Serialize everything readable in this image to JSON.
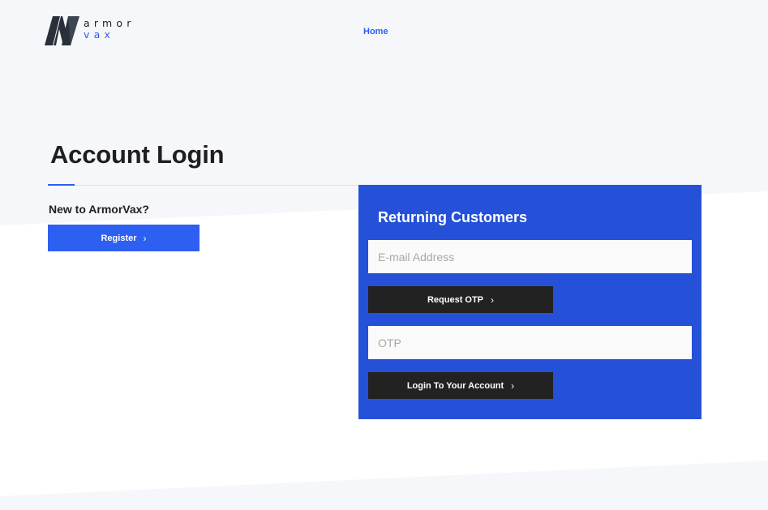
{
  "brand": {
    "logo_top": "armor",
    "logo_bottom": "vax",
    "colors": {
      "accent": "#2d5ff0",
      "panel": "#2451d8",
      "dark": "#222222",
      "background": "#f6f7fa"
    }
  },
  "nav": {
    "home_label": "Home"
  },
  "page": {
    "title": "Account Login"
  },
  "new_customer": {
    "heading": "New to ArmorVax?",
    "register_label": "Register",
    "register_icon": "chevron-right-icon"
  },
  "returning": {
    "heading": "Returning Customers",
    "email_placeholder": "E-mail Address",
    "email_value": "",
    "request_otp_label": "Request OTP",
    "otp_placeholder": "OTP",
    "otp_value": "",
    "login_label": "Login To Your Account",
    "button_icon": "chevron-right-icon"
  }
}
